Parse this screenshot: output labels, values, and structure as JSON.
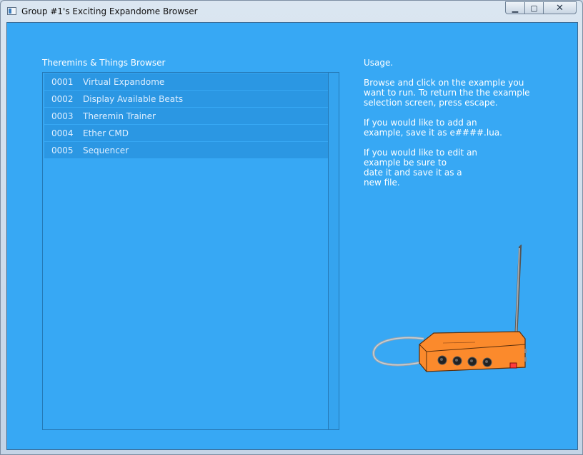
{
  "window": {
    "title": "Group #1's Exciting Expandome Browser",
    "controls": {
      "minimize": "▁",
      "maximize": "▢",
      "close": "✕"
    }
  },
  "browser": {
    "title": "Theremins & Things Browser",
    "items": [
      {
        "number": "0001",
        "name": "Virtual Expandome"
      },
      {
        "number": "0002",
        "name": "Display Available Beats"
      },
      {
        "number": "0003",
        "name": "Theremin Trainer"
      },
      {
        "number": "0004",
        "name": "Ether CMD"
      },
      {
        "number": "0005",
        "name": "Sequencer"
      }
    ]
  },
  "usage": {
    "heading": "Usage.",
    "paragraph1": "Browse and click on the example you\nwant to run. To return the the example\nselection screen, press escape.",
    "paragraph2": "If you would like to add an\nexample, save it as e####.lua.",
    "paragraph3": "If you would like to edit an\nexample be sure to\ndate it and save it as a\nnew file."
  },
  "colors": {
    "background": "#37a8f4",
    "list_item": "#2b97e3",
    "device_orange": "#fb8a2c"
  },
  "illustration": {
    "icon": "theremin-device-icon"
  }
}
